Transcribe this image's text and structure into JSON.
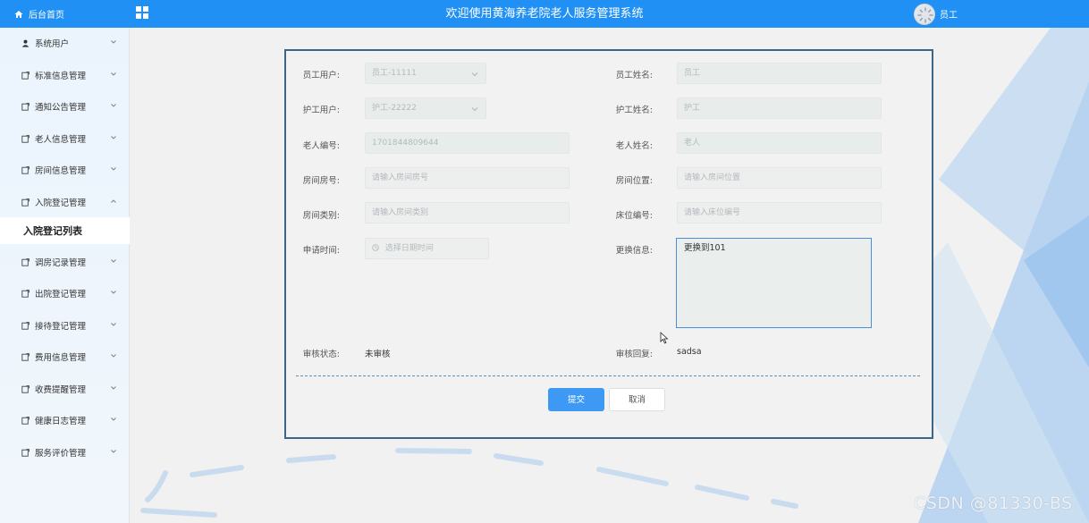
{
  "header": {
    "home_label": "后台首页",
    "title": "欢迎使用黄海养老院老人服务管理系统",
    "user_name": "员工"
  },
  "sidebar": {
    "items": [
      {
        "label": "系统用户",
        "icon": "user-icon",
        "expanded": false
      },
      {
        "label": "标准信息管理",
        "icon": "doc-icon",
        "expanded": false
      },
      {
        "label": "通知公告管理",
        "icon": "doc-icon",
        "expanded": false
      },
      {
        "label": "老人信息管理",
        "icon": "doc-icon",
        "expanded": false
      },
      {
        "label": "房间信息管理",
        "icon": "doc-icon",
        "expanded": false
      },
      {
        "label": "入院登记管理",
        "icon": "doc-icon",
        "expanded": true
      },
      {
        "label": "调房记录管理",
        "icon": "doc-icon",
        "expanded": false
      },
      {
        "label": "出院登记管理",
        "icon": "doc-icon",
        "expanded": false
      },
      {
        "label": "接待登记管理",
        "icon": "doc-icon",
        "expanded": false
      },
      {
        "label": "费用信息管理",
        "icon": "doc-icon",
        "expanded": false
      },
      {
        "label": "收费提醒管理",
        "icon": "doc-icon",
        "expanded": false
      },
      {
        "label": "健康日志管理",
        "icon": "doc-icon",
        "expanded": false
      },
      {
        "label": "服务评价管理",
        "icon": "doc-icon",
        "expanded": false
      }
    ],
    "active_submenu": "入院登记列表"
  },
  "form": {
    "staff_user": {
      "label": "员工用户:",
      "value": "员工-11111"
    },
    "staff_name": {
      "label": "员工姓名:",
      "placeholder": "员工"
    },
    "nurse_user": {
      "label": "护工用户:",
      "value": "护工-22222"
    },
    "nurse_name": {
      "label": "护工姓名:",
      "placeholder": "护工"
    },
    "elder_no": {
      "label": "老人编号:",
      "value": "1701844809644"
    },
    "elder_name": {
      "label": "老人姓名:",
      "placeholder": "老人"
    },
    "room_no": {
      "label": "房间房号:",
      "placeholder": "请输入房间房号"
    },
    "room_location": {
      "label": "房间位置:",
      "placeholder": "请输入房间位置"
    },
    "room_type": {
      "label": "房间类别:",
      "placeholder": "请输入房间类别"
    },
    "bed_no": {
      "label": "床位编号:",
      "placeholder": "请输入床位编号"
    },
    "apply_time": {
      "label": "申请时间:",
      "placeholder": "选择日期时间"
    },
    "change_info": {
      "label": "更换信息:",
      "value": "更换到101"
    },
    "review_status": {
      "label": "审核状态:",
      "value": "未审核"
    },
    "review_reply": {
      "label": "审核回复:",
      "value": "sadsa"
    },
    "submit_label": "提交",
    "cancel_label": "取消"
  },
  "watermark": "CSDN @81330-BS",
  "colors": {
    "header_blue": "#2190f5",
    "primary_button": "#3d99f4",
    "card_border": "#3c6587"
  }
}
